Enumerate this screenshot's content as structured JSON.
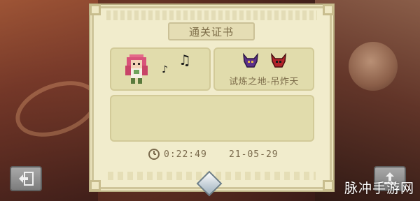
{
  "certificate": {
    "title": "通关证书",
    "location": "试炼之地-吊炸天",
    "time": "0:22:49",
    "date": "21-05-29"
  },
  "icons": {
    "pet": "pixel-character-icon",
    "note_small": "♪",
    "note_large": "♫",
    "boss": "demon-boss-icon",
    "clock": "clock-icon",
    "exit": "exit-icon",
    "share": "share-icon",
    "gem": "crystal-gem-icon"
  },
  "watermark": "脉冲手游网",
  "colors": {
    "panel_bg": "#f1eccc",
    "box_bg": "#e1dcac",
    "text": "#7c6c4a",
    "boss_purple": "#5b2f8a",
    "boss_red": "#b3232a"
  }
}
